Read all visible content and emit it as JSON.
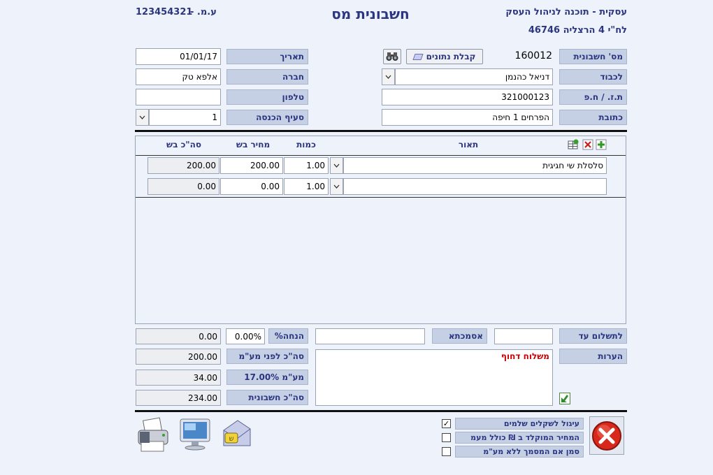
{
  "header": {
    "company_line": "עסקית - תוכנה לניהול העסק",
    "address_line": "לח\"י 4 הרצליה 46746",
    "title": "חשבונית מס",
    "vat_id_label": "ע.מ. -",
    "vat_id_value": "123454321"
  },
  "form": {
    "invoice_no_label": "מס' חשבונית",
    "invoice_no_value": "160012",
    "receive_data_label": "קבלת נתונים",
    "to_label": "לכבוד",
    "to_value": "דניאל כהנמן",
    "id_label": "ת.ז. / ח.פ",
    "id_value": "321000123",
    "address_label": "כתובת",
    "address_value": "הפרחים 1 חיפה",
    "date_label": "תאריך",
    "date_value": "01/01/17",
    "company_label": "חברה",
    "company_value": "אלפא טק",
    "phone_label": "טלפון",
    "phone_value": "",
    "income_section_label": "סעיף הכנסה",
    "income_section_value": "1"
  },
  "table": {
    "headers": {
      "description": "תאור",
      "quantity": "כמות",
      "price": "מחיר בש",
      "total": "סה\"כ בש"
    },
    "rows": [
      {
        "description": "סלסלת שי חגיגית",
        "quantity": "1.00",
        "price": "200.00",
        "total": "200.00"
      },
      {
        "description": "",
        "quantity": "1.00",
        "price": "0.00",
        "total": "0.00"
      }
    ]
  },
  "summary": {
    "payment_until_label": "לתשלום עד",
    "payment_until_value": "",
    "reference_label": "אסמכתא",
    "reference_value": "",
    "discount_label": "%הנחה",
    "discount_pct_value": "0.00%",
    "discount_amount": "0.00",
    "notes_label": "הערות",
    "notes_value": "משלוח דחוף",
    "subtotal_label": "סה\"כ לפני מע\"מ",
    "subtotal_value": "200.00",
    "vat_label": "מע\"מ 17.00%",
    "vat_value": "34.00",
    "total_label": "סה\"כ חשבונית",
    "total_value": "234.00"
  },
  "options": {
    "round_shekels": {
      "label": "עיגול לשקלים שלמים",
      "checked": true
    },
    "price_includes_vat": {
      "label": "המחיר המוקלד ב ₪ כולל מעמ",
      "checked": false
    },
    "mark_no_vat": {
      "label": "סמן אם המסמך ללא מע\"מ",
      "checked": false
    }
  },
  "colors": {
    "label_bg": "#c6d0e4",
    "label_text": "#2b3580",
    "notes_text": "#cc0000",
    "background": "#eef3fb"
  },
  "icons": [
    "binoculars-icon",
    "eraser-icon",
    "add-row-icon",
    "delete-row-icon",
    "insert-row-icon",
    "expand-arrow-icon",
    "close-icon",
    "printer-icon",
    "monitor-icon",
    "email-icon"
  ]
}
